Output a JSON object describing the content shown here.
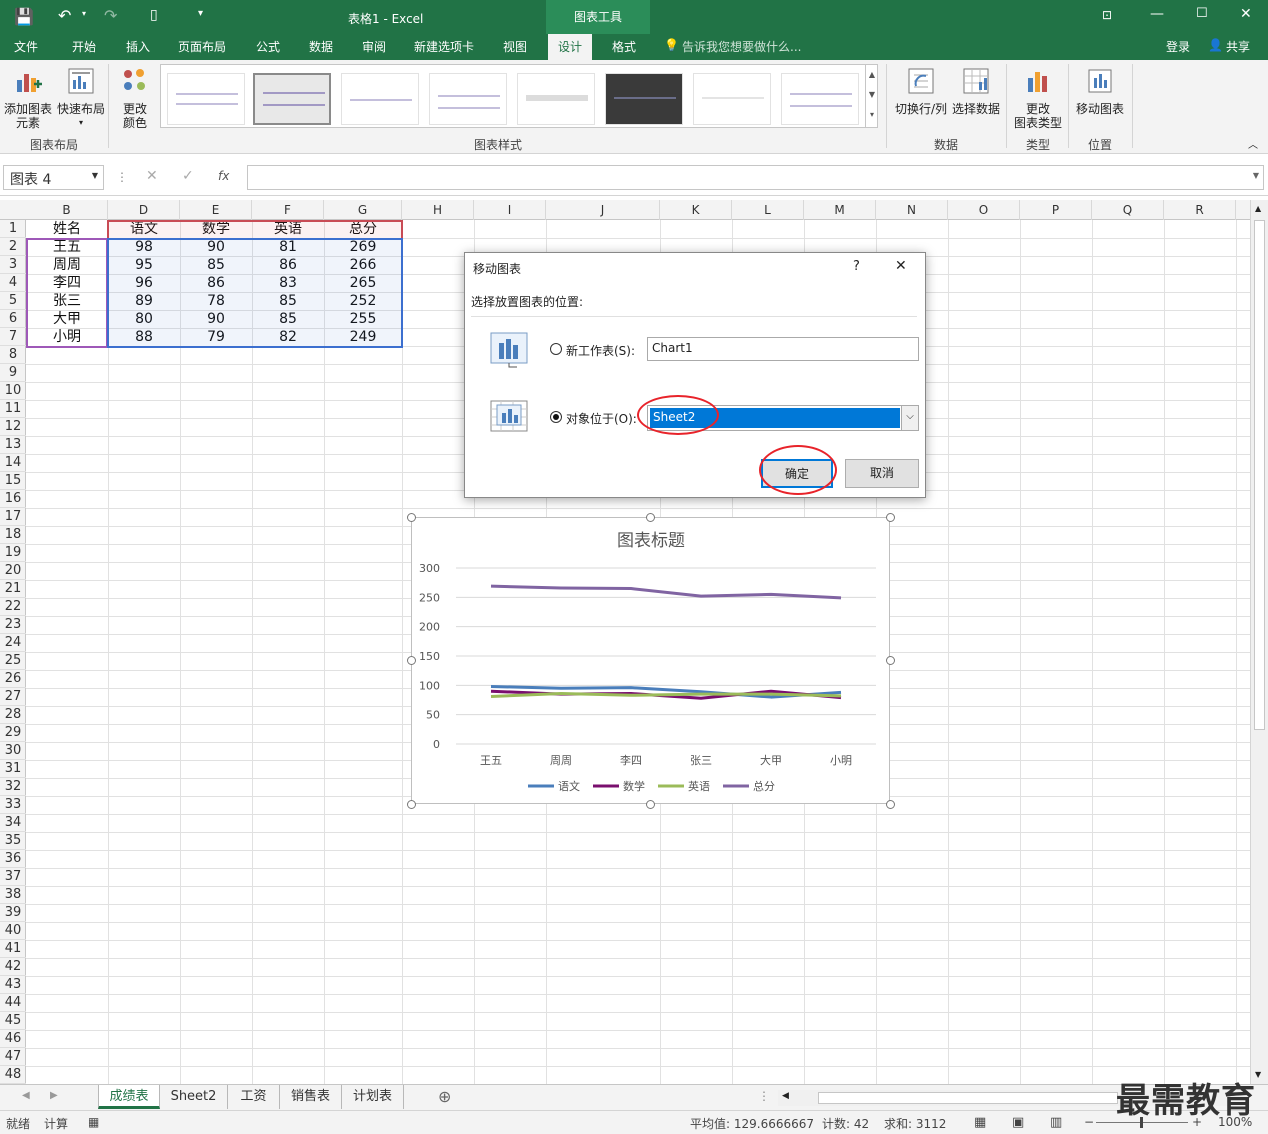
{
  "window": {
    "title": "表格1 - Excel",
    "context_tab": "图表工具",
    "login": "登录",
    "share": "共享"
  },
  "tabs": [
    "文件",
    "开始",
    "插入",
    "页面布局",
    "公式",
    "数据",
    "审阅",
    "新建选项卡",
    "视图",
    "设计",
    "格式"
  ],
  "tell_me": "告诉我您想要做什么...",
  "ribbon": {
    "add_element": [
      "添加图表",
      "元素"
    ],
    "quick_layout": "快速布局",
    "change_color": [
      "更改",
      "颜色"
    ],
    "switch_row_col": "切换行/列",
    "select_data": "选择数据",
    "change_type": [
      "更改",
      "图表类型"
    ],
    "move_chart": "移动图表",
    "groups": {
      "layout": "图表布局",
      "styles": "图表样式",
      "data": "数据",
      "type": "类型",
      "location": "位置"
    }
  },
  "formula_bar": {
    "name_box": "图表 4",
    "fx": "fx"
  },
  "columns": [
    "B",
    "D",
    "E",
    "F",
    "G",
    "H",
    "I",
    "J",
    "K",
    "L",
    "M",
    "N",
    "O",
    "P",
    "Q",
    "R"
  ],
  "rows": [
    "1",
    "2",
    "3",
    "4",
    "5",
    "6",
    "7",
    "8",
    "9",
    "10",
    "11",
    "12",
    "13",
    "14",
    "15",
    "16",
    "17",
    "18",
    "19",
    "20",
    "21",
    "22",
    "23",
    "24",
    "25",
    "26",
    "27",
    "28",
    "29",
    "30",
    "31",
    "32",
    "33",
    "34",
    "35",
    "36",
    "37",
    "38",
    "39",
    "40",
    "41",
    "42",
    "43",
    "44",
    "45",
    "46",
    "47",
    "48"
  ],
  "table": {
    "headers": [
      "姓名",
      "语文",
      "数学",
      "英语",
      "总分"
    ],
    "rows": [
      [
        "王五",
        "98",
        "90",
        "81",
        "269"
      ],
      [
        "周周",
        "95",
        "85",
        "86",
        "266"
      ],
      [
        "李四",
        "96",
        "86",
        "83",
        "265"
      ],
      [
        "张三",
        "89",
        "78",
        "85",
        "252"
      ],
      [
        "大甲",
        "80",
        "90",
        "85",
        "255"
      ],
      [
        "小明",
        "88",
        "79",
        "82",
        "249"
      ]
    ]
  },
  "dialog": {
    "title": "移动图表",
    "help": "?",
    "close": "✕",
    "prompt": "选择放置图表的位置:",
    "new_sheet_label": "新工作表(S):",
    "new_sheet_value": "Chart1",
    "object_in_label": "对象位于(O):",
    "object_in_value": "Sheet2",
    "ok": "确定",
    "cancel": "取消"
  },
  "chart_data": {
    "type": "line",
    "title": "图表标题",
    "categories": [
      "王五",
      "周周",
      "李四",
      "张三",
      "大甲",
      "小明"
    ],
    "series": [
      {
        "name": "语文",
        "values": [
          98,
          95,
          96,
          89,
          80,
          88
        ],
        "color": "#4a7ebb"
      },
      {
        "name": "数学",
        "values": [
          90,
          85,
          86,
          78,
          90,
          79
        ],
        "color": "#7a0f6e"
      },
      {
        "name": "英语",
        "values": [
          81,
          86,
          83,
          85,
          85,
          82
        ],
        "color": "#9bbb59"
      },
      {
        "name": "总分",
        "values": [
          269,
          266,
          265,
          252,
          255,
          249
        ],
        "color": "#8064a2"
      }
    ],
    "ylim": [
      0,
      300
    ],
    "yticks": [
      "0",
      "50",
      "100",
      "150",
      "200",
      "250",
      "300"
    ],
    "grid": true,
    "legend": "bottom"
  },
  "sheets": [
    "成绩表",
    "Sheet2",
    "工资",
    "销售表",
    "计划表"
  ],
  "status": {
    "ready": "就绪",
    "calc": "计算",
    "average": "平均值: 129.6666667",
    "count": "计数: 42",
    "sum": "求和: 3112",
    "zoom": "100%"
  },
  "watermark": "最需教育",
  "colors": {
    "excel_green": "#217346",
    "selection": "#0078d7",
    "ring": "#e8232a"
  }
}
